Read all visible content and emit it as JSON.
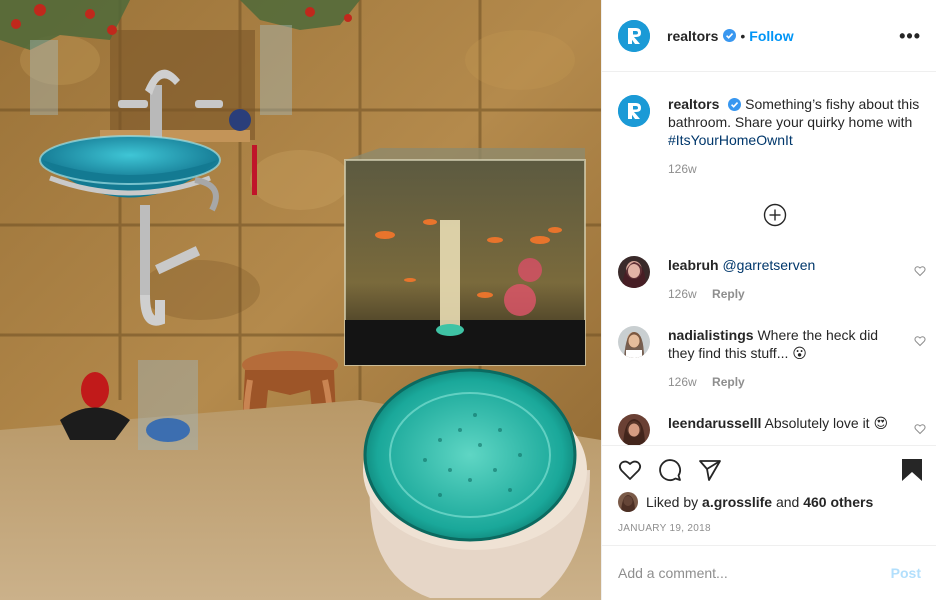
{
  "header": {
    "username": "realtors",
    "separator": "•",
    "follow_label": "Follow",
    "more_label": "•••"
  },
  "caption": {
    "username": "realtors",
    "text": "Something’s fishy about this bathroom. Share your quirky home with",
    "hashtag": "#ItsYourHomeOwnIt",
    "age": "126w"
  },
  "comments": [
    {
      "username": "leabruh",
      "text": "",
      "mention": "@garretserven",
      "age": "126w",
      "reply_label": "Reply"
    },
    {
      "username": "nadialistings",
      "text": "Where the heck did they find this stuff...",
      "emoji": "😮",
      "age": "126w",
      "reply_label": "Reply"
    },
    {
      "username": "leendarusselll",
      "text": "Absolutely love it",
      "emoji": "😍"
    }
  ],
  "likes": {
    "prefix": "Liked by",
    "liker": "a.grosslife",
    "conjunction": "and",
    "others": "460 others"
  },
  "date": "JANUARY 19, 2018",
  "add_comment": {
    "placeholder": "Add a comment...",
    "post_label": "Post"
  },
  "icons": {
    "like": "heart-outline-icon",
    "comment": "speech-bubble-icon",
    "share": "paper-plane-icon",
    "save": "bookmark-filled-icon",
    "load_more": "plus-circle-icon",
    "verified": "verified-badge-icon"
  },
  "colors": {
    "link_blue": "#0095f6",
    "hashtag_blue": "#00376b",
    "muted_gray": "#8e8e8e",
    "brand_logo": "#1b9ad6",
    "post_disabled": "#b2dffc"
  }
}
